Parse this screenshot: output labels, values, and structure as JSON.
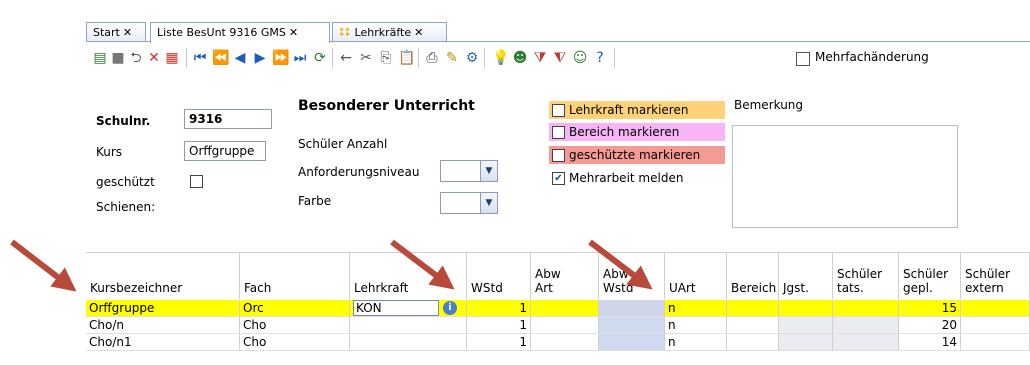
{
  "tabs": [
    {
      "label": "Start",
      "close": "✕"
    },
    {
      "label": "Liste BesUnt 9316 GMS",
      "close": "✕"
    },
    {
      "label": "Lehrkräfte",
      "close": "✕"
    }
  ],
  "toolbar": {
    "multi_edit_label": "Mehrfachänderung"
  },
  "form": {
    "schulnr_label": "Schulnr.",
    "schulnr_value": "9316",
    "kurs_label": "Kurs",
    "kurs_value": "Orffgruppe",
    "geschuetzt_label": "geschützt",
    "schienen_label": "Schienen:",
    "section_title": "Besonderer Unterricht",
    "schueler_anzahl_label": "Schüler Anzahl",
    "anforderungsniveau_label": "Anforderungsniveau",
    "farbe_label": "Farbe",
    "mark_lehrkraft": "Lehrkraft markieren",
    "mark_bereich": "Bereich markieren",
    "mark_geschuetzte": "geschützte markieren",
    "mehrarbeit": "Mehrarbeit melden",
    "mehrarbeit_checked": "✔",
    "bemerkung_label": "Bemerkung",
    "colors": {
      "lehrkraft": "#ffd27a",
      "bereich": "#f7b4f7",
      "geschuetzte": "#f59b96"
    }
  },
  "grid": {
    "headers": [
      "Kursbezeichner",
      "Fach",
      "Lehrkraft",
      "WStd",
      "Abw\nArt",
      "Abw\nWstd",
      "UArt",
      "Bereich",
      "Jgst.",
      "Schüler\ntats.",
      "Schüler\ngepl.",
      "Schüler\nextern"
    ],
    "rows": [
      {
        "kurs": "Orffgruppe",
        "fach": "Orc",
        "lehrkraft": "KON",
        "wstd": "1",
        "uart": "n",
        "gepl": "15"
      },
      {
        "kurs": "Cho/n",
        "fach": "Cho",
        "lehrkraft": "",
        "wstd": "1",
        "uart": "n",
        "gepl": "20"
      },
      {
        "kurs": "Cho/n1",
        "fach": "Cho",
        "lehrkraft": "",
        "wstd": "1",
        "uart": "n",
        "gepl": "14"
      }
    ],
    "selected_color": "#ffff00"
  }
}
